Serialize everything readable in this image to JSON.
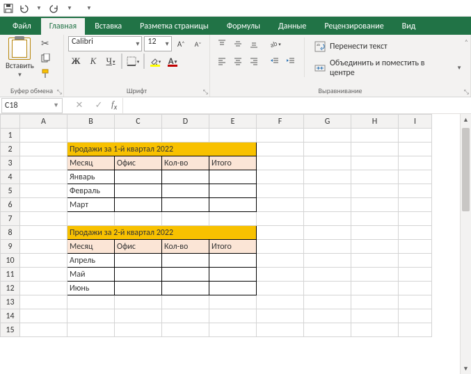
{
  "qat": {
    "save": "💾",
    "undo": "↶",
    "redo": "↷"
  },
  "tabs": {
    "file": "Файл",
    "home": "Главная",
    "insert": "Вставка",
    "layout": "Разметка страницы",
    "formulas": "Формулы",
    "data": "Данные",
    "review": "Рецензирование",
    "view": "Вид"
  },
  "ribbon": {
    "clipboard": {
      "paste": "Вставить",
      "label": "Буфер обмена"
    },
    "font": {
      "name": "Calibri",
      "size": "12",
      "label": "Шрифт"
    },
    "alignment": {
      "wrap": "Перенести текст",
      "merge": "Объединить и поместить в центре",
      "label": "Выравнивание"
    }
  },
  "namebox": "C18",
  "formula": "",
  "columns": [
    "A",
    "B",
    "C",
    "D",
    "E",
    "F",
    "G",
    "H",
    "I"
  ],
  "rows": [
    "1",
    "2",
    "3",
    "4",
    "5",
    "6",
    "7",
    "8",
    "9",
    "10",
    "11",
    "12",
    "13",
    "14",
    "15"
  ],
  "cells": {
    "B2": "Продажи за 1-й квартал 2022",
    "B3": "Месяц",
    "C3": "Офис",
    "D3": "Кол-во",
    "E3": "Итого",
    "B4": "Январь",
    "B5": "Февраль",
    "B6": "Март",
    "B8": "Продажи за 2-й квартал 2022",
    "B9": "Месяц",
    "C9": "Офис",
    "D9": "Кол-во",
    "E9": "Итого",
    "B10": "Апрель",
    "B11": "Май",
    "B12": "Июнь"
  }
}
